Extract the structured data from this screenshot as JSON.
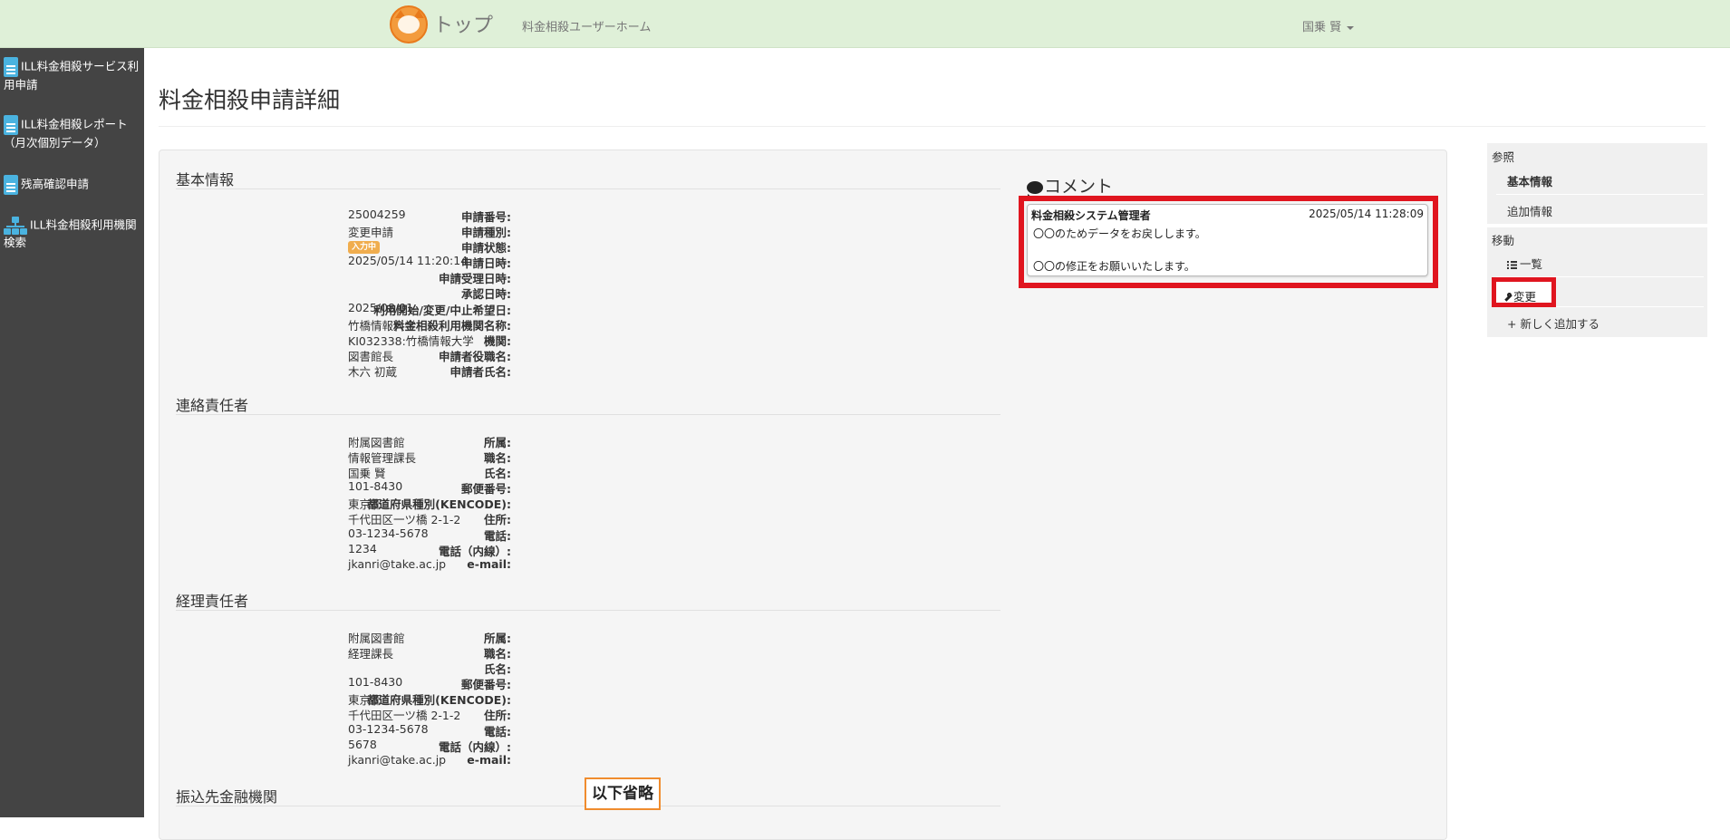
{
  "navbar": {
    "brand": "トップ",
    "home_link": "料金相殺ユーザーホーム",
    "user_menu": "国乗 賢",
    "logo_icon": "cat-logo-icon"
  },
  "sidebar": {
    "items": [
      {
        "icon": "document-icon",
        "label_l1": "ILL料金相殺サービス利",
        "label_l2": "用申請"
      },
      {
        "icon": "document-icon",
        "label_l1": "ILL料金相殺レポート",
        "label_l2": "（月次個別データ）"
      },
      {
        "icon": "document-icon",
        "label_l1": "残高確認申請",
        "label_l2": ""
      },
      {
        "icon": "sitemap-icon",
        "label_l1": "ILL料金相殺利用機関",
        "label_l2": "検索"
      }
    ]
  },
  "page": {
    "title": "料金相殺申請詳細"
  },
  "basic": {
    "heading": "基本情報",
    "rows": [
      {
        "k": "申請番号:",
        "v": "25004259"
      },
      {
        "k": "申請種別:",
        "v": "変更申請"
      },
      {
        "k": "申請状態:",
        "v": ""
      },
      {
        "k": "申請日時:",
        "v": "2025/05/14 11:20:14"
      },
      {
        "k": "申請受理日時:",
        "v": ""
      },
      {
        "k": "承認日時:",
        "v": ""
      },
      {
        "k": "利用開始/変更/中止希望日:",
        "v": "2025/08/01"
      },
      {
        "k": "料金相殺利用機関名称:",
        "v": "竹橋情報大学"
      },
      {
        "k": "機関:",
        "v": "KI032338:竹橋情報大学"
      },
      {
        "k": "申請者役職名:",
        "v": "図書館長"
      },
      {
        "k": "申請者氏名:",
        "v": "木六 初蔵"
      }
    ],
    "status_badge": "入力中",
    "status_color": "#f0ad4e"
  },
  "contact": {
    "heading": "連絡責任者",
    "rows": [
      {
        "k": "所属:",
        "v": "附属図書館"
      },
      {
        "k": "職名:",
        "v": "情報管理課長"
      },
      {
        "k": "氏名:",
        "v": "国乗 賢"
      },
      {
        "k": "郵便番号:",
        "v": "101-8430"
      },
      {
        "k": "都道府県種別(KENCODE):",
        "v": "東京都"
      },
      {
        "k": "住所:",
        "v": "千代田区一ツ橋 2-1-2"
      },
      {
        "k": "電話:",
        "v": "03-1234-5678"
      },
      {
        "k": "電話（内線）:",
        "v": "1234"
      },
      {
        "k": "e-mail:",
        "v": "jkanri@take.ac.jp"
      }
    ]
  },
  "accounting": {
    "heading": "経理責任者",
    "rows": [
      {
        "k": "所属:",
        "v": "附属図書館"
      },
      {
        "k": "職名:",
        "v": "経理課長"
      },
      {
        "k": "氏名:",
        "v": ""
      },
      {
        "k": "郵便番号:",
        "v": "101-8430"
      },
      {
        "k": "都道府県種別(KENCODE):",
        "v": "東京都"
      },
      {
        "k": "住所:",
        "v": "千代田区一ツ橋 2-1-2"
      },
      {
        "k": "電話:",
        "v": "03-1234-5678"
      },
      {
        "k": "電話（内線）:",
        "v": "5678"
      },
      {
        "k": "e-mail:",
        "v": "jkanri@take.ac.jp"
      }
    ]
  },
  "bank": {
    "heading": "振込先金融機関"
  },
  "omit_label": "以下省略",
  "comment": {
    "heading": "コメント",
    "author": "料金相殺システム管理者",
    "datetime": "2025/05/14 11:28:09",
    "line1": "〇〇のためデータをお戻しします。",
    "line2": "〇〇の修正をお願いいたします。"
  },
  "right_nav": {
    "ref_heading": "参照",
    "basic_info": "基本情報",
    "additional_info": "追加情報",
    "move_heading": "移動",
    "list": "一覧",
    "change": "変更",
    "add_new": "+ 新しく追加する"
  },
  "highlight_color": "#e0151f",
  "omit_border_color": "#f08c2e"
}
